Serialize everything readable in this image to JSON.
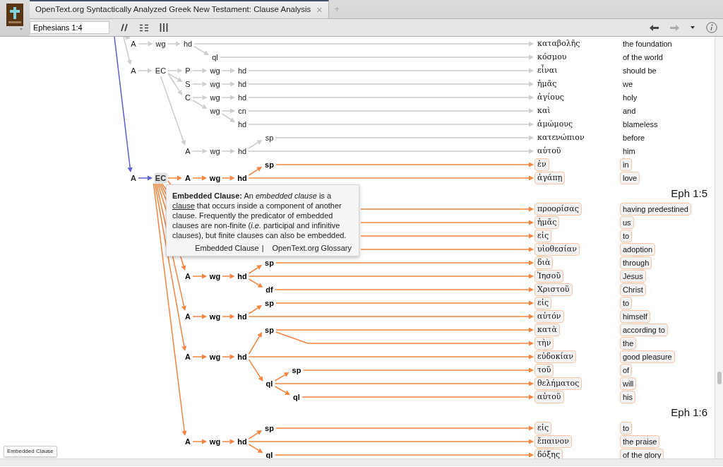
{
  "tab": {
    "title": "OpenText.org Syntactically Analyzed Greek New Testament: Clause Analysis",
    "close": "×",
    "new_tab": "+"
  },
  "toolbar": {
    "reference": "Ephesians 1:4"
  },
  "tree": [
    {
      "label": "A",
      "selected": false,
      "highlighted": false,
      "children": [
        {
          "label": "wg",
          "selected": false,
          "highlighted": false,
          "children": [
            {
              "label": "hd",
              "selected": false,
              "highlighted": false,
              "linked": true,
              "children": [
                {
                  "label": "ql",
                  "selected": false,
                  "highlighted": false,
                  "linked": true
                }
              ]
            }
          ]
        }
      ]
    },
    {
      "label": "A",
      "selected": false,
      "highlighted": false,
      "children": [
        {
          "label": "EC",
          "selected": false,
          "highlighted": false,
          "children": [
            {
              "label": "P",
              "selected": false,
              "highlighted": false,
              "children": [
                {
                  "label": "wg",
                  "selected": false,
                  "highlighted": false,
                  "children": [
                    {
                      "label": "hd",
                      "selected": false,
                      "highlighted": false,
                      "linked": true
                    }
                  ]
                }
              ]
            },
            {
              "label": "S",
              "selected": false,
              "highlighted": false,
              "children": [
                {
                  "label": "wg",
                  "selected": false,
                  "highlighted": false,
                  "children": [
                    {
                      "label": "hd",
                      "selected": false,
                      "highlighted": false,
                      "linked": true
                    }
                  ]
                }
              ]
            },
            {
              "label": "C",
              "selected": false,
              "highlighted": false,
              "children": [
                {
                  "label": "wg",
                  "selected": false,
                  "highlighted": false,
                  "children": [
                    {
                      "label": "hd",
                      "selected": false,
                      "highlighted": false,
                      "linked": true
                    }
                  ]
                },
                {
                  "label": "wg",
                  "selected": false,
                  "highlighted": false,
                  "children": [
                    {
                      "label": "cn",
                      "selected": false,
                      "highlighted": false,
                      "linked": true
                    },
                    {
                      "label": "hd",
                      "selected": false,
                      "highlighted": false,
                      "linked": true
                    }
                  ]
                }
              ]
            },
            {
              "label": "A",
              "selected": false,
              "highlighted": false,
              "children": [
                {
                  "label": "wg",
                  "selected": false,
                  "highlighted": false,
                  "children": [
                    {
                      "label": "hd",
                      "selected": false,
                      "highlighted": false,
                      "above": [
                        {
                          "label": "sp",
                          "selected": false,
                          "highlighted": false,
                          "linked": true
                        }
                      ],
                      "linked": true
                    }
                  ]
                }
              ]
            }
          ]
        }
      ]
    },
    {
      "label": "A",
      "selected": false,
      "highlighted": false,
      "children": [
        {
          "label": "EC",
          "selected": true,
          "highlighted": false,
          "children": [
            {
              "label": "A",
              "selected": false,
              "highlighted": true,
              "children": [
                {
                  "label": "wg",
                  "selected": false,
                  "highlighted": true,
                  "children": [
                    {
                      "label": "hd",
                      "selected": false,
                      "highlighted": true,
                      "above": [
                        {
                          "label": "sp",
                          "selected": false,
                          "highlighted": true,
                          "linked": true
                        }
                      ],
                      "linked": true
                    }
                  ]
                }
              ]
            },
            {
              "highlighted": true,
              "linked": true
            },
            {
              "highlighted": true,
              "linked": true
            },
            {
              "highlighted": true,
              "linked": true
            },
            {
              "highlighted": true,
              "linked": true
            },
            {
              "label": "A",
              "selected": false,
              "highlighted": true,
              "children": [
                {
                  "label": "wg",
                  "selected": false,
                  "highlighted": true,
                  "children": [
                    {
                      "label": "hd",
                      "selected": false,
                      "highlighted": true,
                      "above": [
                        {
                          "label": "sp",
                          "selected": false,
                          "highlighted": true,
                          "linked": true
                        }
                      ],
                      "linked": true,
                      "children": [
                        {
                          "label": "df",
                          "selected": false,
                          "highlighted": true,
                          "linked": true
                        }
                      ]
                    }
                  ]
                }
              ]
            },
            {
              "label": "A",
              "selected": false,
              "highlighted": true,
              "children": [
                {
                  "label": "wg",
                  "selected": false,
                  "highlighted": true,
                  "children": [
                    {
                      "label": "hd",
                      "selected": false,
                      "highlighted": true,
                      "above": [
                        {
                          "label": "sp",
                          "selected": false,
                          "highlighted": true,
                          "linked": true
                        }
                      ],
                      "linked": true
                    }
                  ]
                }
              ]
            },
            {
              "label": "A",
              "selected": false,
              "highlighted": true,
              "children": [
                {
                  "label": "wg",
                  "selected": false,
                  "highlighted": true,
                  "children": [
                    {
                      "label": "hd",
                      "selected": false,
                      "highlighted": true,
                      "above": [
                        {
                          "label": "sp",
                          "selected": false,
                          "highlighted": true,
                          "linked": true,
                          "second_link": true
                        }
                      ],
                      "linked": true,
                      "children": [
                        {
                          "label": "ql",
                          "selected": false,
                          "highlighted": true,
                          "above": [
                            {
                              "label": "sp",
                              "selected": false,
                              "highlighted": true,
                              "linked": true
                            }
                          ],
                          "linked": true,
                          "children": [
                            {
                              "label": "ql",
                              "selected": false,
                              "highlighted": true,
                              "linked": true
                            }
                          ]
                        }
                      ]
                    }
                  ]
                }
              ]
            },
            {
              "label": "A",
              "selected": false,
              "highlighted": true,
              "children": [
                {
                  "label": "wg",
                  "selected": false,
                  "highlighted": true,
                  "children": [
                    {
                      "label": "hd",
                      "selected": false,
                      "highlighted": true,
                      "above": [
                        {
                          "label": "sp",
                          "selected": false,
                          "highlighted": true,
                          "linked": true
                        }
                      ],
                      "linked": true,
                      "children": [
                        {
                          "label": "ql",
                          "selected": false,
                          "highlighted": true,
                          "linked": true
                        }
                      ]
                    }
                  ]
                }
              ]
            }
          ]
        }
      ]
    }
  ],
  "rows": [
    {
      "kind": "word",
      "greek": "καταβολῆς",
      "gloss": "the foundation",
      "highlighted": false
    },
    {
      "kind": "word",
      "greek": "κόσμου",
      "gloss": "of the world",
      "highlighted": false
    },
    {
      "kind": "word",
      "greek": "εἶναι",
      "gloss": "should be",
      "highlighted": false
    },
    {
      "kind": "word",
      "greek": "ἡμᾶς",
      "gloss": "we",
      "highlighted": false
    },
    {
      "kind": "word",
      "greek": "ἁγίους",
      "gloss": "holy",
      "highlighted": false
    },
    {
      "kind": "word",
      "greek": "καὶ",
      "gloss": "and",
      "highlighted": false
    },
    {
      "kind": "word",
      "greek": "ἀμώμους",
      "gloss": "blameless",
      "highlighted": false
    },
    {
      "kind": "word",
      "greek": "κατενώπιον",
      "gloss": "before",
      "highlighted": false
    },
    {
      "kind": "word",
      "greek": "αὐτοῦ",
      "gloss": "him",
      "highlighted": false
    },
    {
      "kind": "word",
      "greek": "ἐν",
      "gloss": "in",
      "highlighted": true
    },
    {
      "kind": "word",
      "greek": "ἀγάπῃ",
      "gloss": "love",
      "highlighted": true
    },
    {
      "kind": "verse",
      "reference": "Eph 1:5"
    },
    {
      "kind": "word",
      "greek": "προορίσας",
      "gloss": "having predestined",
      "highlighted": true
    },
    {
      "kind": "word",
      "greek": "ἡμᾶς",
      "gloss": "us",
      "highlighted": true
    },
    {
      "kind": "word",
      "greek": "εἰς",
      "gloss": "to",
      "highlighted": true
    },
    {
      "kind": "word",
      "greek": "υἱοθεσίαν",
      "gloss": "adoption",
      "highlighted": true
    },
    {
      "kind": "word",
      "greek": "διὰ",
      "gloss": "through",
      "highlighted": true
    },
    {
      "kind": "word",
      "greek": "Ἰησοῦ",
      "gloss": "Jesus",
      "highlighted": true
    },
    {
      "kind": "word",
      "greek": "Χριστοῦ",
      "gloss": "Christ",
      "highlighted": true
    },
    {
      "kind": "word",
      "greek": "εἰς",
      "gloss": "to",
      "highlighted": true
    },
    {
      "kind": "word",
      "greek": "αὐτόν",
      "gloss": "himself",
      "highlighted": true
    },
    {
      "kind": "word",
      "greek": "κατὰ",
      "gloss": "according to",
      "highlighted": true
    },
    {
      "kind": "word",
      "greek": "τὴν",
      "gloss": "the",
      "highlighted": true
    },
    {
      "kind": "word",
      "greek": "εὐδοκίαν",
      "gloss": "good pleasure",
      "highlighted": true
    },
    {
      "kind": "word",
      "greek": "τοῦ",
      "gloss": "of",
      "highlighted": true
    },
    {
      "kind": "word",
      "greek": "θελήματος",
      "gloss": "will",
      "highlighted": true
    },
    {
      "kind": "word",
      "greek": "αὐτοῦ",
      "gloss": "his",
      "highlighted": true
    },
    {
      "kind": "verse",
      "reference": "Eph 1:6"
    },
    {
      "kind": "word",
      "greek": "εἰς",
      "gloss": "to",
      "highlighted": true
    },
    {
      "kind": "word",
      "greek": "ἔπαινον",
      "gloss": "the praise",
      "highlighted": true
    },
    {
      "kind": "word",
      "greek": "δόξης",
      "gloss": "of the glory",
      "highlighted": true
    }
  ],
  "tooltip": {
    "text_before": "**Embedded Clause:** An *embedded clause* is a ",
    "link": "clause",
    "text_after": " that occurs inside a component of another clause. Frequently the predicator of embedded clauses are non-finite (*i.e.* participal and infinitive clauses), but finite clauses can also be embedded.",
    "footer_link": "Embedded Clause",
    "separator": "|",
    "glossary_link": "OpenText.org Glossary"
  },
  "status_label": "Embedded Clause"
}
